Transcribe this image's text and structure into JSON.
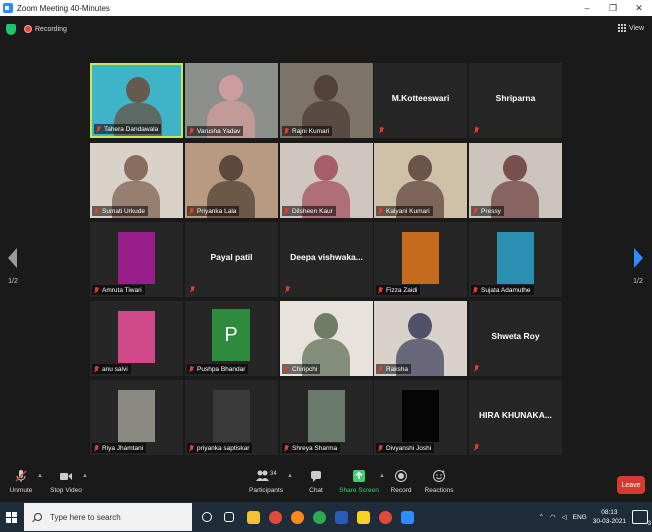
{
  "window": {
    "title": "Zoom Meeting 40-Minutes",
    "minimize": "–",
    "maximize": "❐",
    "close": "✕"
  },
  "meeting": {
    "recording_label": "Recording",
    "view_label": "View",
    "page_indicator_left": "1/2",
    "page_indicator_right": "1/2"
  },
  "tiles": [
    {
      "name": "Tahera Dandawala",
      "kind": "video",
      "bg": "#3fb3c8",
      "fg": "#6b4a3a",
      "active": true
    },
    {
      "name": "Varusha Yadav",
      "kind": "video",
      "bg": "#8c8f8a",
      "fg": "#d8a0a0"
    },
    {
      "name": "Rajni Kumari",
      "kind": "video",
      "bg": "#7d7468",
      "fg": "#4a3a33"
    },
    {
      "name": "M.Kotteeswari",
      "kind": "nameonly"
    },
    {
      "name": "Shriparna",
      "kind": "nameonly"
    },
    {
      "name": "Sumati Urkude",
      "kind": "video",
      "bg": "#d8d2c8",
      "fg": "#7a5a4a"
    },
    {
      "name": "Priyanka Lala",
      "kind": "video",
      "bg": "#b89a82",
      "fg": "#4b3a30"
    },
    {
      "name": "Dilsheen Kaur",
      "kind": "video",
      "bg": "#d0c6c0",
      "fg": "#a04a5a"
    },
    {
      "name": "Kalyani Kumari",
      "kind": "video",
      "bg": "#cfc0a8",
      "fg": "#5a4038"
    },
    {
      "name": "Pressy",
      "kind": "video",
      "bg": "#cbc5bd",
      "fg": "#6a3b3a"
    },
    {
      "name": "Amruta Tiwari",
      "kind": "video",
      "bg": "#262626",
      "fg": "#9a1e8a",
      "square": true
    },
    {
      "name": "Payal patil",
      "kind": "nameonly"
    },
    {
      "name": "Deepa  vishwaka...",
      "kind": "nameonly"
    },
    {
      "name": "Fizza Zaidi",
      "kind": "video",
      "bg": "#2a2a2a",
      "fg": "#c46b1e",
      "square": true
    },
    {
      "name": "Sujata Adamuthe",
      "kind": "video",
      "bg": "#2a2a2a",
      "fg": "#2a8fb0",
      "square": true
    },
    {
      "name": "anu salvi",
      "kind": "video",
      "bg": "#2a2a2a",
      "fg": "#d04a8a",
      "square": true
    },
    {
      "name": "Pushpa Bhandar",
      "kind": "avatar",
      "letter": "P",
      "bg": "#2e8b3e"
    },
    {
      "name": "Chiripchi",
      "kind": "video",
      "bg": "#e8e2dc",
      "fg": "#5a6a50"
    },
    {
      "name": "Raksha",
      "kind": "video",
      "bg": "#d8d2ca",
      "fg": "#3a3a5a"
    },
    {
      "name": "Shweta Roy",
      "kind": "nameonly"
    },
    {
      "name": "Riya Jhamtani",
      "kind": "video",
      "bg": "#2a2a2a",
      "fg": "#8a8a82",
      "square": true
    },
    {
      "name": "priyanka saptiskar",
      "kind": "video",
      "bg": "#2a2a2a",
      "fg": "#3a3a3a",
      "square": true
    },
    {
      "name": "Shreya Sharma",
      "kind": "video",
      "bg": "#2a2a2a",
      "fg": "#6a7a6a",
      "square": true
    },
    {
      "name": "Divyanshi Joshi",
      "kind": "video",
      "bg": "#262626",
      "fg": "#050505",
      "square": true
    },
    {
      "name": "HIRA  KHUNAKA...",
      "kind": "nameonly"
    }
  ],
  "toolbar": {
    "unmute": "Unmute",
    "stop_video": "Stop Video",
    "participants": "Participants",
    "participants_count": "34",
    "chat": "Chat",
    "share_screen": "Share Screen",
    "record": "Record",
    "reactions": "Reactions",
    "leave": "Leave"
  },
  "taskbar": {
    "search_placeholder": "Type here to search",
    "language": "ENG",
    "time": "08:13",
    "date": "30-03-2021",
    "notification_count": "3",
    "apps": [
      {
        "name": "cortana",
        "color": "#ffffff"
      },
      {
        "name": "task-view",
        "color": "#ffffff"
      },
      {
        "name": "file-explorer",
        "color": "#f2c230"
      },
      {
        "name": "chrome",
        "color": "#e04a3a"
      },
      {
        "name": "firefox",
        "color": "#ff8a1e"
      },
      {
        "name": "chrome-badge",
        "color": "#2fa84f"
      },
      {
        "name": "word",
        "color": "#2b5bb8"
      },
      {
        "name": "sticky-notes",
        "color": "#f7d21e"
      },
      {
        "name": "chrome-2",
        "color": "#e04a3a"
      },
      {
        "name": "zoom",
        "color": "#2d8cff"
      }
    ]
  },
  "colors": {
    "accent": "#2d8cff",
    "active_speaker": "#c6e85a",
    "muted_mic": "#e03e2f",
    "share": "#3ccf72",
    "leave": "#d63a2e"
  }
}
